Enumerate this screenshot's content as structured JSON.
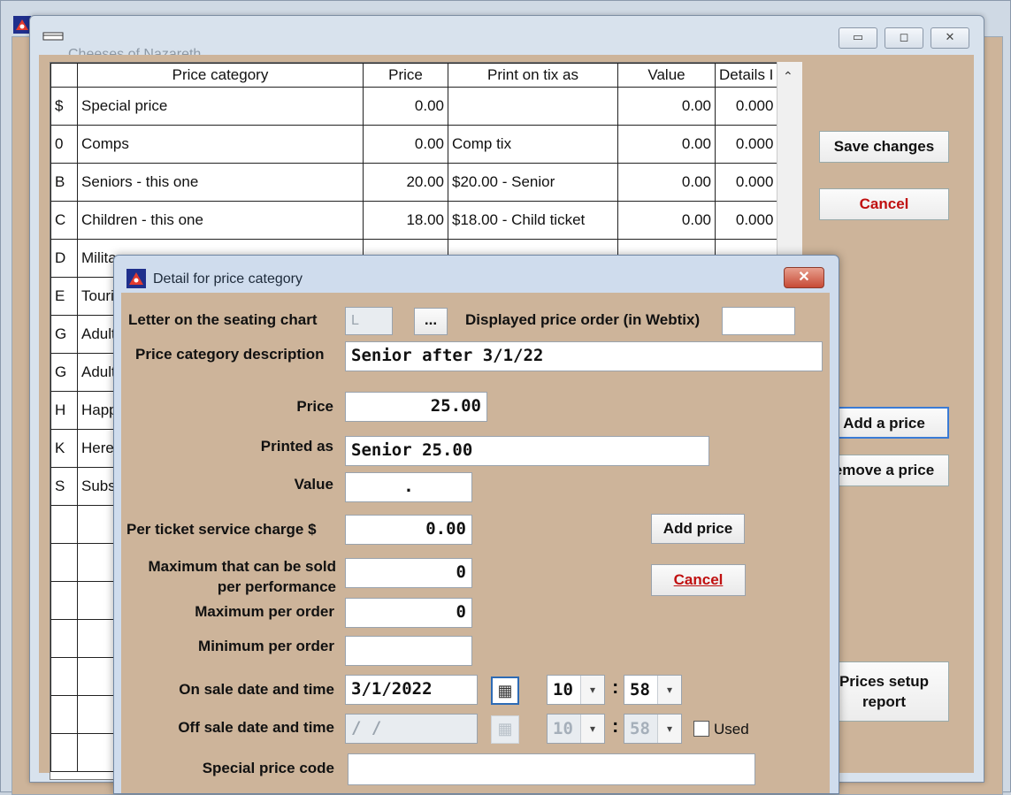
{
  "outer": {
    "icon": "app-icon"
  },
  "main": {
    "title": "Cheeses of Nazareth",
    "controls": {
      "minimize": "▭",
      "maximize": "◻",
      "close": "✕"
    },
    "grid": {
      "columns": [
        "",
        "Price category",
        "Price",
        "Print on tix as",
        "Value",
        "Details I"
      ],
      "rows": [
        [
          "$",
          "Special price",
          "0.00",
          "",
          "0.00",
          "0.000"
        ],
        [
          "0",
          "Comps",
          "0.00",
          "Comp tix",
          "0.00",
          "0.000"
        ],
        [
          "B",
          "Seniors - this one",
          "20.00",
          "$20.00 - Senior",
          "0.00",
          "0.000"
        ],
        [
          "C",
          "Children - this one",
          "18.00",
          "$18.00 - Child ticket",
          "0.00",
          "0.000"
        ],
        [
          "D",
          "Milita",
          "",
          "",
          "",
          ""
        ],
        [
          "E",
          "Touri",
          "",
          "",
          "",
          ""
        ],
        [
          "G",
          "Adult",
          "",
          "",
          "",
          ""
        ],
        [
          "G",
          "Adult",
          "",
          "",
          "",
          ""
        ],
        [
          "H",
          "Happ",
          "",
          "",
          "",
          ""
        ],
        [
          "K",
          "Here",
          "",
          "",
          "",
          ""
        ],
        [
          "S",
          "Subs",
          "",
          "",
          "",
          ""
        ],
        [
          "",
          "",
          "",
          "",
          "",
          ""
        ],
        [
          "",
          "",
          "",
          "",
          "",
          ""
        ],
        [
          "",
          "",
          "",
          "",
          "",
          ""
        ],
        [
          "",
          "",
          "",
          "",
          "",
          ""
        ],
        [
          "",
          "",
          "",
          "",
          "",
          ""
        ],
        [
          "",
          "",
          "",
          "",
          "",
          ""
        ],
        [
          "",
          "",
          "",
          "",
          "",
          ""
        ]
      ]
    },
    "buttons": {
      "save": "Save changes",
      "cancel": "Cancel",
      "add": "Add a price",
      "remove": "emove a price",
      "report_line1": "Prices setup",
      "report_line2": "report"
    }
  },
  "dialog": {
    "title": "Detail for price category",
    "close": "✕",
    "letter_label": "Letter on the seating chart",
    "letter_value": "L",
    "ellipsis": "...",
    "order_label": "Displayed price order (in Webtix)",
    "order_value": "",
    "desc_label": "Price category description",
    "desc_value": "Senior after 3/1/22",
    "price_label": "Price",
    "price_value": "25.00",
    "printed_label": "Printed as",
    "printed_value": "Senior 25.00",
    "value_label": "Value",
    "value_value": ".",
    "service_label": "Per ticket service charge $",
    "service_value": "0.00",
    "maxperf_label1": "Maximum that can be sold",
    "maxperf_label2": "per performance",
    "maxperf_value": "0",
    "maxorder_label": "Maximum per order",
    "maxorder_value": "0",
    "minorder_label": "Minimum per order",
    "minorder_value": "",
    "onsale_label": "On sale date and time",
    "onsale_date": "3/1/2022",
    "onsale_hour": "10",
    "onsale_min": "58",
    "offsale_label": "Off sale date and time",
    "offsale_date": "  /  /",
    "offsale_hour": "10",
    "offsale_min": "58",
    "used_label": "Used",
    "special_label": "Special price code",
    "special_value": "",
    "add_button": "Add price",
    "cancel_button": "Cancel"
  }
}
